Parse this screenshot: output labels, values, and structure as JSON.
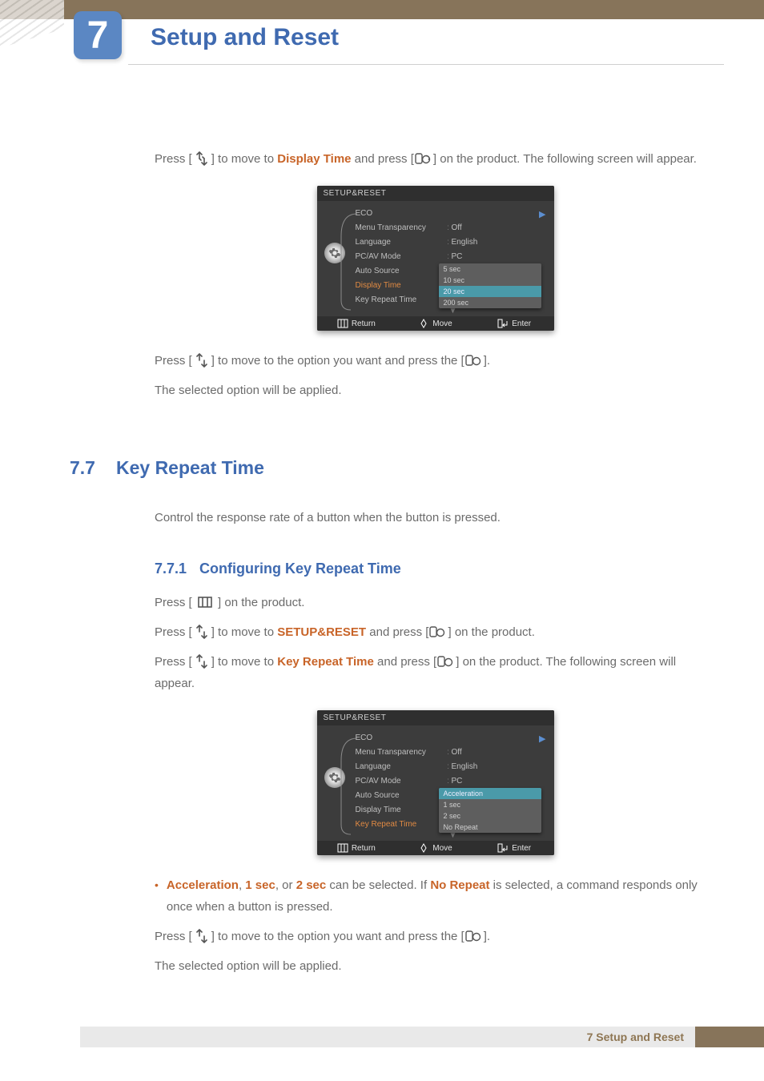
{
  "chapter": {
    "number": "7",
    "title": "Setup and Reset"
  },
  "para1": {
    "pre": "Press [",
    "mid": "] to move to ",
    "link": "Display Time",
    "post1": " and press [",
    "post2": "] on the product. The following screen will appear."
  },
  "osd1": {
    "title": "SETUP&RESET",
    "rows": [
      {
        "label": "ECO",
        "val": ""
      },
      {
        "label": "Menu Transparency",
        "val": "Off"
      },
      {
        "label": "Language",
        "val": "English"
      },
      {
        "label": "PC/AV Mode",
        "val": "PC"
      },
      {
        "label": "Auto Source",
        "val": ""
      },
      {
        "label": "Display Time",
        "val": "",
        "hl": true
      },
      {
        "label": "Key Repeat Time",
        "val": ""
      }
    ],
    "dropdown": [
      "5 sec",
      "10 sec",
      "20 sec",
      "200 sec"
    ],
    "dd_selected": 2,
    "footer": {
      "return": "Return",
      "move": "Move",
      "enter": "Enter"
    }
  },
  "para2": {
    "pre": "Press [",
    "mid": "] to move to the option you want and press the [",
    "post": "]."
  },
  "para3": "The selected option will be applied.",
  "section": {
    "num": "7.7",
    "title": "Key Repeat Time"
  },
  "section_desc": "Control the response rate of a button when the button is pressed.",
  "subsection": {
    "num": "7.7.1",
    "title": "Configuring Key Repeat Time"
  },
  "step1": {
    "pre": "Press [ ",
    "post": " ] on the product."
  },
  "step2": {
    "pre": "Press [",
    "mid": "] to move to ",
    "link": "SETUP&RESET",
    "post1": " and press [",
    "post2": "] on the product."
  },
  "step3": {
    "pre": "Press [",
    "mid": "] to move to ",
    "link": "Key Repeat Time",
    "post1": " and press [",
    "post2": "] on the product. The following screen will appear."
  },
  "osd2": {
    "title": "SETUP&RESET",
    "rows": [
      {
        "label": "ECO",
        "val": ""
      },
      {
        "label": "Menu Transparency",
        "val": "Off"
      },
      {
        "label": "Language",
        "val": "English"
      },
      {
        "label": "PC/AV Mode",
        "val": "PC"
      },
      {
        "label": "Auto Source",
        "val": ""
      },
      {
        "label": "Display Time",
        "val": ""
      },
      {
        "label": "Key Repeat Time",
        "val": "",
        "hl": true
      }
    ],
    "dropdown": [
      "Acceleration",
      "1 sec",
      "2 sec",
      "No Repeat"
    ],
    "dd_selected": 0,
    "footer": {
      "return": "Return",
      "move": "Move",
      "enter": "Enter"
    }
  },
  "bullet": {
    "w1": "Acceleration",
    "sep1": ", ",
    "w2": "1 sec",
    "sep2": ", or ",
    "w3": "2 sec",
    "mid": " can be selected. If ",
    "w4": "No Repeat",
    "post": " is selected, a command responds only once when a button is pressed."
  },
  "para4": {
    "pre": "Press [",
    "mid": "] to move to the option you want and press the [",
    "post": "]."
  },
  "para5": "The selected option will be applied.",
  "footer": {
    "text": "7 Setup and Reset"
  }
}
